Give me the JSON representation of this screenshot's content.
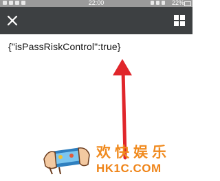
{
  "status_bar": {
    "time": "22:00",
    "battery": "22%"
  },
  "toolbar": {
    "close_icon": "close-icon",
    "menu_icon": "grid-menu-icon",
    "bar_color": "#3d4042"
  },
  "content": {
    "json_response": "{\"isPassRiskControl\":true}"
  },
  "annotation": {
    "arrow_color": "#e0262b"
  },
  "watermark": {
    "chinese": "欢快娱乐",
    "domain": "HK1C.COM",
    "color": "#f08a1e"
  }
}
